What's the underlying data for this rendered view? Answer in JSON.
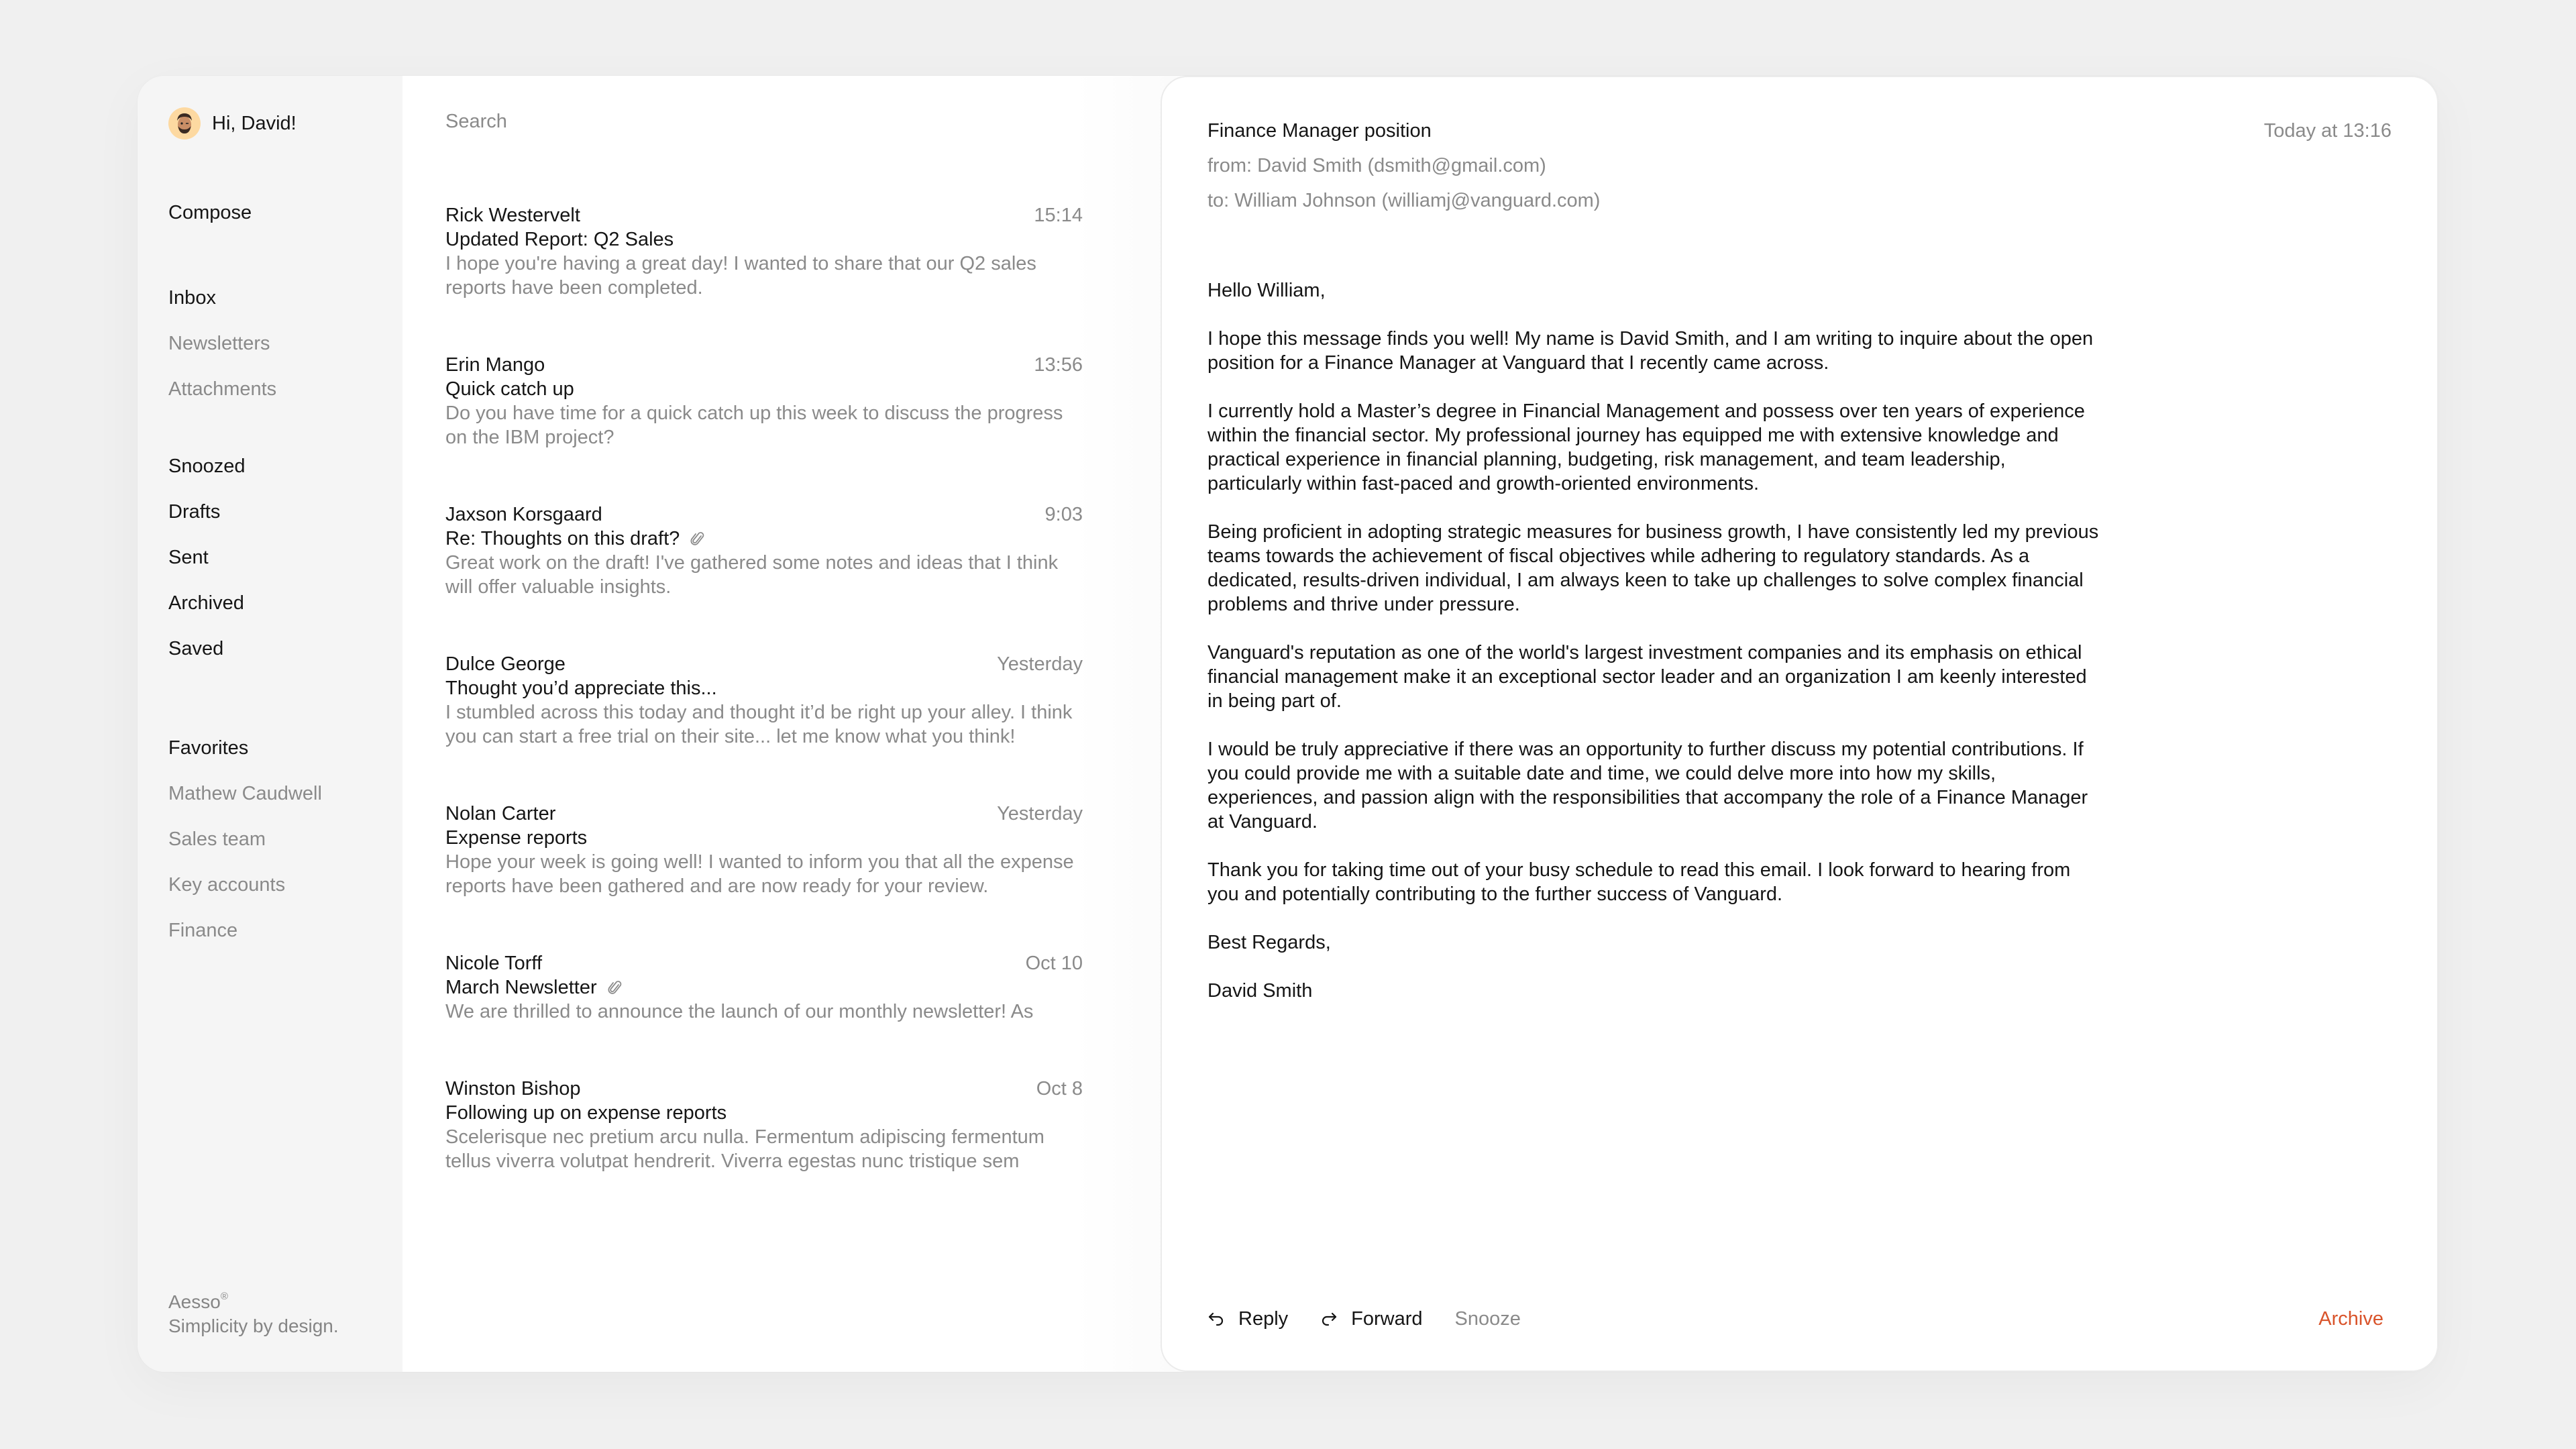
{
  "sidebar": {
    "greeting": "Hi, David!",
    "avatar_icon": "memoji-avatar",
    "compose_label": "Compose",
    "main_items": [
      {
        "label": "Inbox",
        "style": "primary"
      },
      {
        "label": "Newsletters",
        "style": "muted"
      },
      {
        "label": "Attachments",
        "style": "muted"
      }
    ],
    "folder_items": [
      {
        "label": "Snoozed"
      },
      {
        "label": "Drafts"
      },
      {
        "label": "Sent"
      },
      {
        "label": "Archived"
      },
      {
        "label": "Saved"
      }
    ],
    "favorites_label": "Favorites",
    "favorite_items": [
      {
        "label": "Mathew Caudwell"
      },
      {
        "label": "Sales team"
      },
      {
        "label": "Key accounts"
      },
      {
        "label": "Finance"
      }
    ],
    "brand": "Aesso",
    "brand_mark": "®",
    "tagline": "Simplicity by design."
  },
  "list": {
    "search_placeholder": "Search",
    "emails": [
      {
        "sender": "Rick Westervelt",
        "time": "15:14",
        "subject": "Updated Report: Q2 Sales",
        "attachment": false,
        "preview": "I hope you're having a great day! I wanted to share that our Q2 sales reports have been completed."
      },
      {
        "sender": "Erin Mango",
        "time": "13:56",
        "subject": "Quick catch up",
        "attachment": false,
        "preview": "Do you have time for a quick catch up this week to discuss the progress on the IBM project?"
      },
      {
        "sender": "Jaxson Korsgaard",
        "time": "9:03",
        "subject": "Re: Thoughts on this draft?",
        "attachment": true,
        "preview": "Great work on the draft! I've gathered some notes and ideas that I think will offer valuable insights."
      },
      {
        "sender": "Dulce George",
        "time": "Yesterday",
        "subject": "Thought you’d appreciate this...",
        "attachment": false,
        "preview": "I stumbled across this today and thought it’d be right up your alley. I think you can start a free trial on their site... let me know what you think!"
      },
      {
        "sender": "Nolan Carter",
        "time": "Yesterday",
        "subject": "Expense reports",
        "attachment": false,
        "preview": "Hope your week is going well! I wanted to inform you that all the expense reports have been gathered and are now ready for your review."
      },
      {
        "sender": "Nicole Torff",
        "time": "Oct 10",
        "subject": "March Newsletter",
        "attachment": true,
        "preview": "We are thrilled to announce the launch of our monthly newsletter! As"
      },
      {
        "sender": "Winston Bishop",
        "time": "Oct 8",
        "subject": "Following up on expense reports",
        "attachment": false,
        "preview": "Scelerisque nec pretium arcu nulla. Fermentum adipiscing fermentum tellus viverra volutpat hendrerit. Viverra egestas nunc tristique sem"
      }
    ]
  },
  "reader": {
    "subject": "Finance Manager position",
    "date": "Today at 13:16",
    "from": "from: David Smith (dsmith@gmail.com)",
    "to": "to: William Johnson (williamj@vanguard.com)",
    "body": [
      "Hello William,",
      "I hope this message finds you well! My name is David Smith, and I am writing to inquire about the open position for a Finance Manager at Vanguard that I recently came across.",
      "I currently hold a Master’s degree in Financial Management and possess over ten years of experience within the financial sector. My professional journey has equipped me with extensive knowledge and practical experience in financial planning, budgeting, risk management, and team leadership, particularly within fast-paced and growth-oriented environments.",
      "Being proficient in adopting strategic measures for business growth, I have consistently led my previous teams towards the achievement of fiscal objectives while adhering to regulatory standards. As a dedicated, results-driven individual, I am always keen to take up challenges to solve complex financial problems and thrive under pressure.",
      "Vanguard's reputation as one of the world's largest investment companies and its emphasis on ethical financial management make it an exceptional sector leader and an organization I am keenly interested in being part of.",
      "I would be truly appreciative if there was an opportunity to further discuss my potential contributions. If you could provide me with a suitable date and time, we could delve more into how my skills, experiences, and passion align with the responsibilities that accompany the role of a Finance Manager at Vanguard.",
      "Thank you for taking time out of your busy schedule to read this email. I look forward to hearing from you and potentially contributing to the further success of Vanguard.",
      "Best Regards,",
      "David Smith"
    ],
    "actions": {
      "reply": "Reply",
      "forward": "Forward",
      "snooze": "Snooze",
      "archive": "Archive"
    }
  },
  "colors": {
    "accent_archive": "#d9542b",
    "muted_text": "#8a8a8a",
    "primary_text": "#151515",
    "sidebar_bg": "#f5f5f5",
    "avatar_bg": "#fdd9a1"
  }
}
